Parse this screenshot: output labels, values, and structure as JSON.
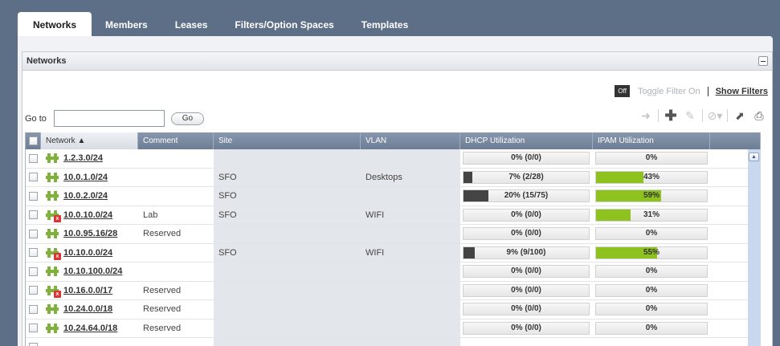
{
  "tabs": [
    "Networks",
    "Members",
    "Leases",
    "Filters/Option Spaces",
    "Templates"
  ],
  "section": {
    "title": "Networks"
  },
  "filter": {
    "off_label": "Off",
    "toggle_label": "Toggle Filter On",
    "show_filters_label": "Show Filters"
  },
  "goto": {
    "label": "Go to",
    "value": "",
    "button_label": "Go"
  },
  "toolbar": {
    "icons": [
      "arrow-right-icon",
      "add-icon",
      "edit-icon",
      "options-icon",
      "open-external-icon",
      "print-icon"
    ]
  },
  "table": {
    "columns": [
      "Network ▲",
      "Comment",
      "Site",
      "VLAN",
      "DHCP Utilization",
      "IPAM Utilization"
    ],
    "rows": [
      {
        "network": "1.2.3.0/24",
        "comment": "",
        "site": "",
        "vlan": "",
        "dhcp": "0% (0/0)",
        "dhcp_pct": 0,
        "ipam": "0%",
        "ipam_pct": 0,
        "disabled": false
      },
      {
        "network": "10.0.1.0/24",
        "comment": "",
        "site": "SFO",
        "vlan": "Desktops",
        "dhcp": "7% (2/28)",
        "dhcp_pct": 7,
        "ipam": "43%",
        "ipam_pct": 43,
        "disabled": false
      },
      {
        "network": "10.0.2.0/24",
        "comment": "",
        "site": "SFO",
        "vlan": "",
        "dhcp": "20% (15/75)",
        "dhcp_pct": 20,
        "ipam": "59%",
        "ipam_pct": 59,
        "disabled": false
      },
      {
        "network": "10.0.10.0/24",
        "comment": "Lab",
        "site": "SFO",
        "vlan": "WIFI",
        "dhcp": "0% (0/0)",
        "dhcp_pct": 0,
        "ipam": "31%",
        "ipam_pct": 31,
        "disabled": true
      },
      {
        "network": "10.0.95.16/28",
        "comment": "Reserved",
        "site": "",
        "vlan": "",
        "dhcp": "0% (0/0)",
        "dhcp_pct": 0,
        "ipam": "0%",
        "ipam_pct": 0,
        "disabled": false
      },
      {
        "network": "10.10.0.0/24",
        "comment": "",
        "site": "SFO",
        "vlan": "WIFI",
        "dhcp": "9% (9/100)",
        "dhcp_pct": 9,
        "ipam": "55%",
        "ipam_pct": 55,
        "disabled": true
      },
      {
        "network": "10.10.100.0/24",
        "comment": "",
        "site": "",
        "vlan": "",
        "dhcp": "0% (0/0)",
        "dhcp_pct": 0,
        "ipam": "0%",
        "ipam_pct": 0,
        "disabled": false
      },
      {
        "network": "10.16.0.0/17",
        "comment": "Reserved",
        "site": "",
        "vlan": "",
        "dhcp": "0% (0/0)",
        "dhcp_pct": 0,
        "ipam": "0%",
        "ipam_pct": 0,
        "disabled": true
      },
      {
        "network": "10.24.0.0/18",
        "comment": "Reserved",
        "site": "",
        "vlan": "",
        "dhcp": "0% (0/0)",
        "dhcp_pct": 0,
        "ipam": "0%",
        "ipam_pct": 0,
        "disabled": false
      },
      {
        "network": "10.24.64.0/18",
        "comment": "Reserved",
        "site": "",
        "vlan": "",
        "dhcp": "0% (0/0)",
        "dhcp_pct": 0,
        "ipam": "0%",
        "ipam_pct": 0,
        "disabled": false
      },
      {
        "network": "",
        "comment": "",
        "site": "",
        "vlan": "",
        "dhcp": "",
        "dhcp_pct": 0,
        "ipam": "",
        "ipam_pct": 0,
        "disabled": false
      }
    ]
  },
  "colors": {
    "ipam_bar": "#8dc21f",
    "dhcp_bar": "#444444",
    "network_icon": "#7fb23a",
    "header": "#5d6f87"
  }
}
